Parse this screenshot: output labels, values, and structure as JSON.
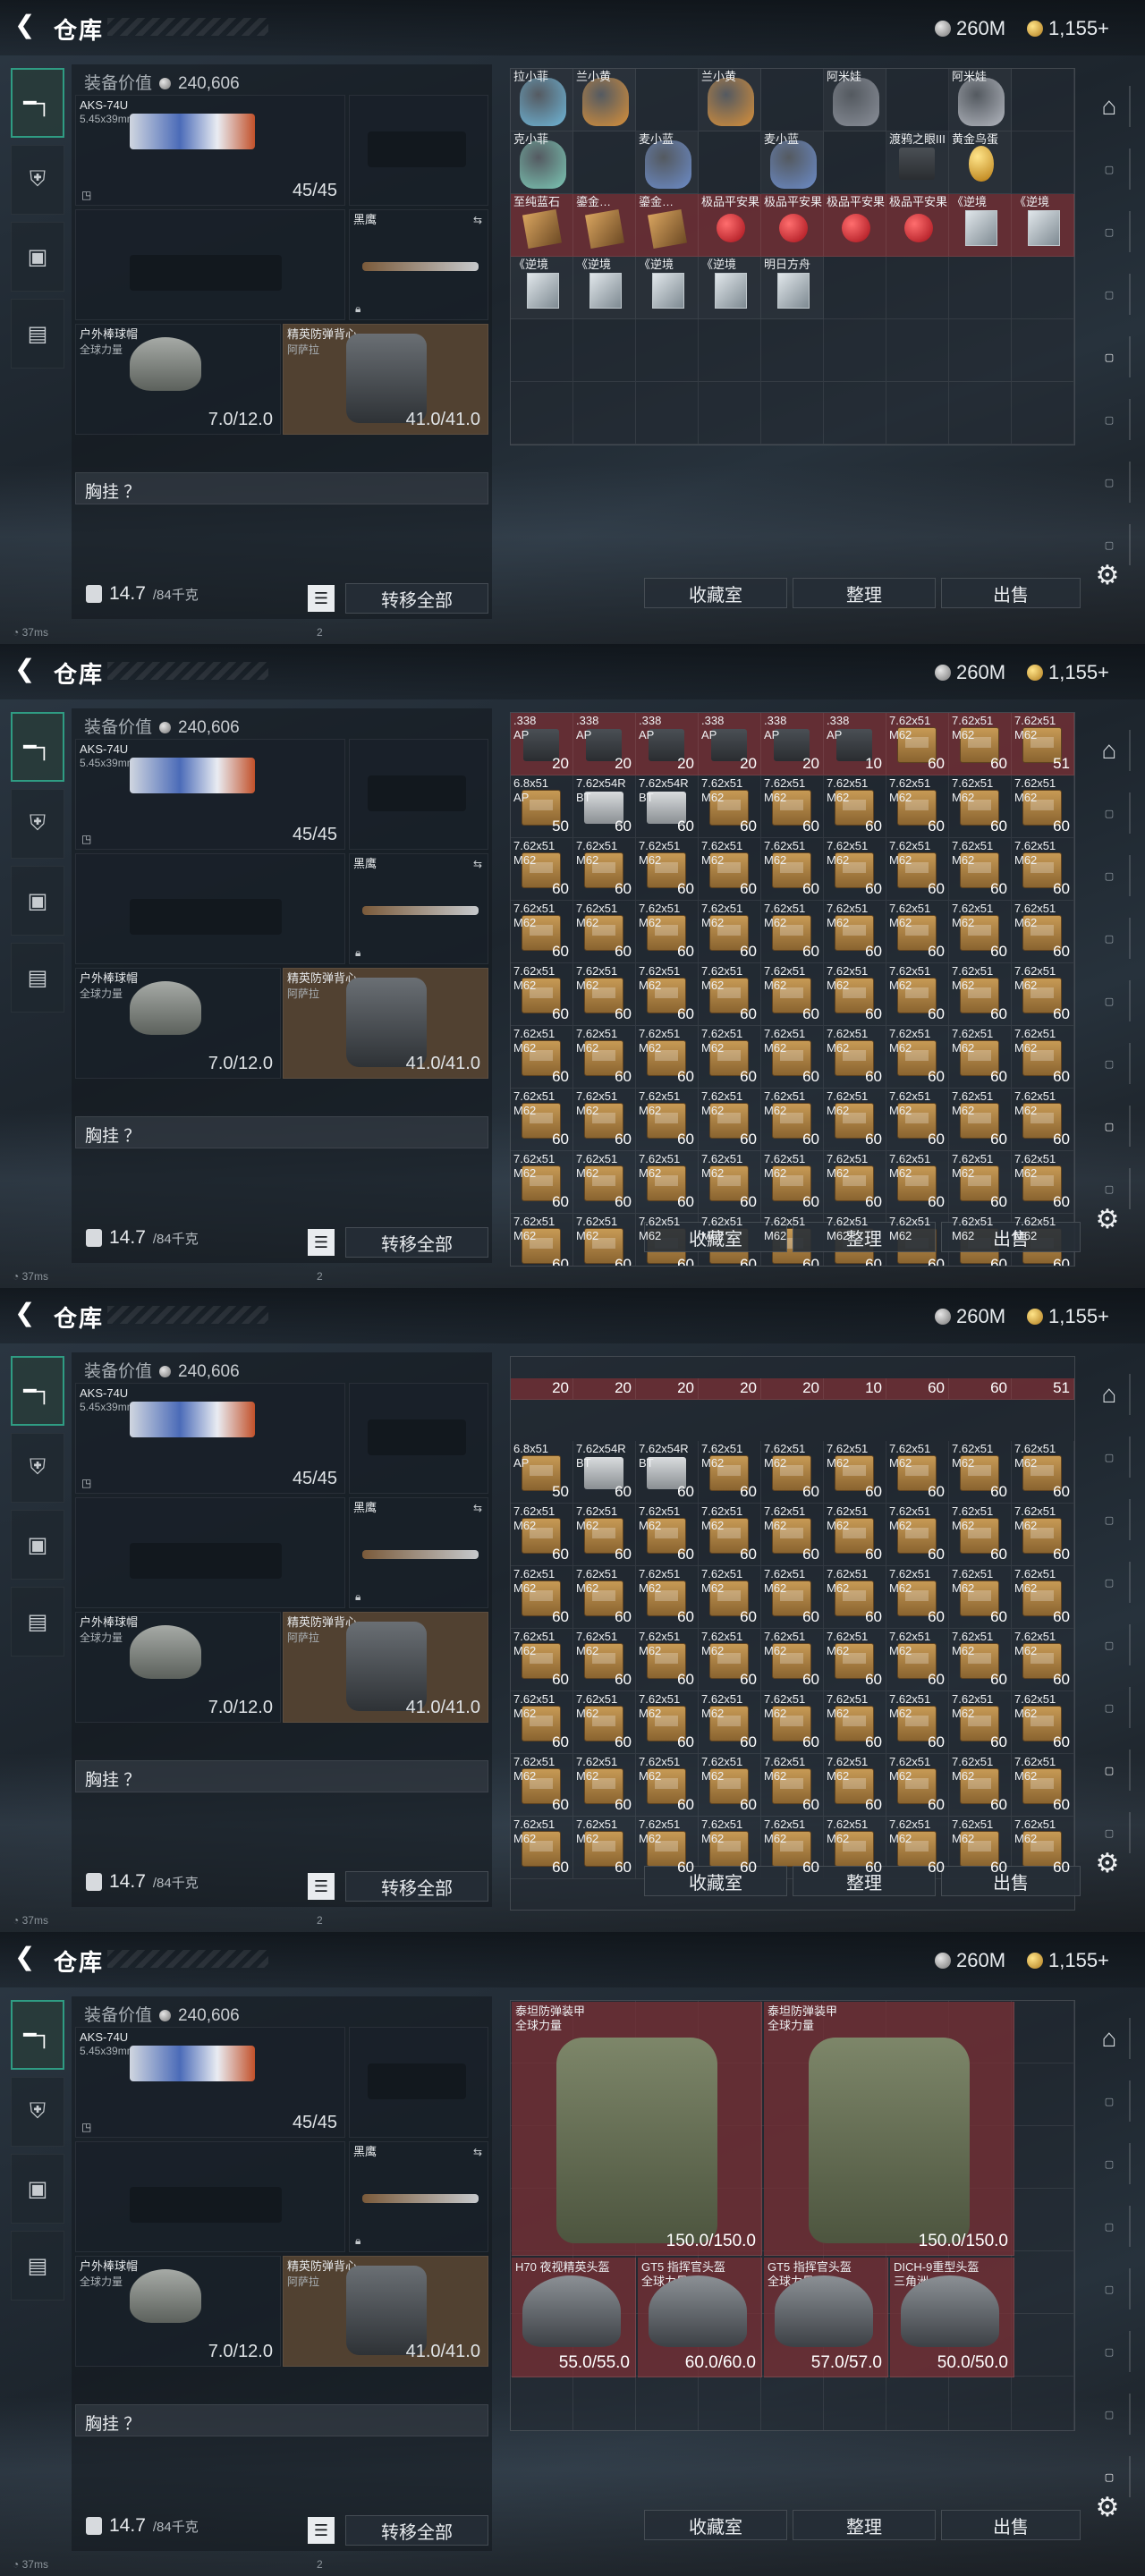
{
  "common": {
    "title": "仓库",
    "currency_silver": "260M",
    "currency_gold": "1,155+",
    "equip_value_label": "装备价值",
    "equip_value": "240,606",
    "weapon1_name": "AKS-74U",
    "weapon1_caliber": "5.45x39mm",
    "weapon1_ammo": "45/45",
    "melee_name": "黑鹰",
    "helmet_name": "户外棒球帽",
    "helmet_sub": "全球力量",
    "helmet_dur": "7.0/12.0",
    "armor_name": "精英防弹背心",
    "armor_sub": "阿萨拉",
    "armor_dur": "41.0/41.0",
    "chest_label": "胸挂 ？",
    "weight_value": "14.7",
    "weight_unit": "/84千克",
    "transfer_all": "转移全部",
    "btn_collection": "收藏室",
    "btn_organize": "整理",
    "btn_sell": "出售",
    "status_ping": "37ms",
    "status_num": "2"
  },
  "panel1": {
    "cells": [
      {
        "n": "拉小菲",
        "t": "toy",
        "c": "#6fb6d8",
        "r": 0
      },
      {
        "n": "兰小黄",
        "t": "toy",
        "c": "#d8903a",
        "r": 0
      },
      {
        "n": "",
        "t": "",
        "r": 0
      },
      {
        "n": "兰小黄",
        "t": "toy",
        "c": "#d8903a",
        "r": 0
      },
      {
        "n": "",
        "t": "",
        "r": 0
      },
      {
        "n": "阿米娃",
        "t": "toy",
        "c": "#8a8f99",
        "r": 0
      },
      {
        "n": "",
        "t": "",
        "r": 0
      },
      {
        "n": "阿米娃",
        "t": "toy",
        "c": "#b3b7bf",
        "r": 0
      },
      {
        "n": "",
        "t": "",
        "r": 0
      },
      {
        "n": "克小菲",
        "t": "toy",
        "c": "#7cc7b5",
        "r": 0
      },
      {
        "n": "",
        "t": "",
        "r": 0
      },
      {
        "n": "麦小蓝",
        "t": "toy",
        "c": "#6c8cc9",
        "r": 0
      },
      {
        "n": "",
        "t": "",
        "r": 0
      },
      {
        "n": "麦小蓝",
        "t": "toy",
        "c": "#6c8cc9",
        "r": 0
      },
      {
        "n": "",
        "t": "",
        "r": 0
      },
      {
        "n": "渡鸦之眼III",
        "t": "case",
        "r": 0
      },
      {
        "n": "黄金鸟蛋",
        "t": "egg",
        "r": 0
      },
      {
        "n": "",
        "t": "",
        "r": 0
      },
      {
        "n": "至纯蓝石",
        "t": "stone",
        "r": 1
      },
      {
        "n": "鎏金…",
        "t": "stone",
        "r": 1
      },
      {
        "n": "鎏金…",
        "t": "stone",
        "r": 1
      },
      {
        "n": "极品平安果",
        "t": "apple",
        "r": 1
      },
      {
        "n": "极品平安果",
        "t": "apple",
        "r": 1
      },
      {
        "n": "极品平安果",
        "t": "apple",
        "r": 1
      },
      {
        "n": "极品平安果",
        "t": "apple",
        "r": 1
      },
      {
        "n": "《逆境",
        "t": "crystal",
        "r": 1
      },
      {
        "n": "《逆境",
        "t": "crystal",
        "r": 1
      },
      {
        "n": "《逆境",
        "t": "crystal",
        "r": 0
      },
      {
        "n": "《逆境",
        "t": "crystal",
        "r": 0
      },
      {
        "n": "《逆境",
        "t": "crystal",
        "r": 0
      },
      {
        "n": "《逆境",
        "t": "crystal",
        "r": 0
      },
      {
        "n": "明日方舟",
        "t": "crystal",
        "r": 0
      }
    ]
  },
  "panel2": {
    "row0": [
      {
        "n": ".338",
        "n2": "AP",
        "t": "case338",
        "c": "20"
      },
      {
        "n": ".338",
        "n2": "AP",
        "t": "case338",
        "c": "20"
      },
      {
        "n": ".338",
        "n2": "AP",
        "t": "case338",
        "c": "20"
      },
      {
        "n": ".338",
        "n2": "AP",
        "t": "case338",
        "c": "20"
      },
      {
        "n": ".338",
        "n2": "AP",
        "t": "case338",
        "c": "20"
      },
      {
        "n": ".338",
        "n2": "AP",
        "t": "case338",
        "c": "10"
      },
      {
        "n": "7.62x51",
        "n2": "M62",
        "t": "ammo",
        "c": "60"
      },
      {
        "n": "7.62x51",
        "n2": "M62",
        "t": "ammo",
        "c": "60"
      },
      {
        "n": "7.62x51",
        "n2": "M62",
        "t": "ammo",
        "c": "51"
      }
    ],
    "row1": [
      {
        "n": "6.8x51",
        "n2": "AP",
        "t": "ammo",
        "c": "50"
      },
      {
        "n": "7.62x54R",
        "n2": "BT",
        "t": "boxw",
        "c": "60"
      },
      {
        "n": "7.62x54R",
        "n2": "BT",
        "t": "boxw",
        "c": "60"
      },
      {
        "n": "7.62x51",
        "n2": "M62",
        "t": "ammo",
        "c": "60"
      },
      {
        "n": "7.62x51",
        "n2": "M62",
        "t": "ammo",
        "c": "60"
      },
      {
        "n": "7.62x51",
        "n2": "M62",
        "t": "ammo",
        "c": "60"
      },
      {
        "n": "7.62x51",
        "n2": "M62",
        "t": "ammo",
        "c": "60"
      },
      {
        "n": "7.62x51",
        "n2": "M62",
        "t": "ammo",
        "c": "60"
      },
      {
        "n": "7.62x51",
        "n2": "M62",
        "t": "ammo",
        "c": "60"
      }
    ],
    "fill_name": "7.62x51",
    "fill_name2": "M62",
    "fill_count": "60"
  },
  "panel3": {
    "top_counts": [
      "20",
      "20",
      "20",
      "20",
      "20",
      "10",
      "60",
      "60",
      "51"
    ]
  },
  "panel4": {
    "big": [
      {
        "n": "泰坦防弹装甲",
        "s": "全球力量",
        "d": "150.0/150.0"
      },
      {
        "n": "泰坦防弹装甲",
        "s": "全球力量",
        "d": "150.0/150.0"
      }
    ],
    "small": [
      {
        "n": "H70 夜视精英头盔",
        "s": "",
        "d": "55.0/55.0"
      },
      {
        "n": "GT5 指挥官头盔",
        "s": "全球力量",
        "d": "60.0/60.0"
      },
      {
        "n": "GT5 指挥官头盔",
        "s": "全球力量",
        "d": "57.0/57.0"
      },
      {
        "n": "DICH-9重型头盔",
        "s": "三角洲",
        "d": "50.0/50.0"
      }
    ]
  }
}
